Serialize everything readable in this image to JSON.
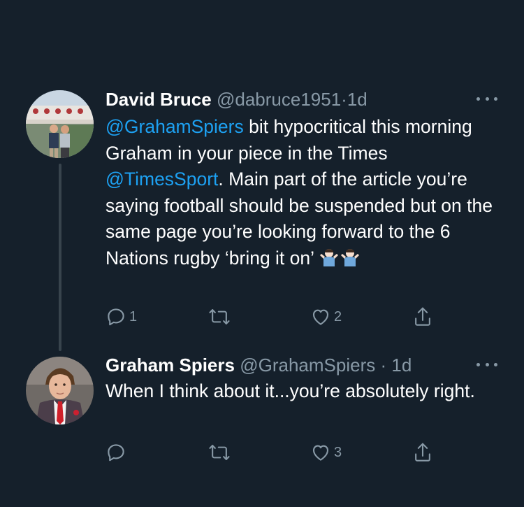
{
  "colors": {
    "background": "#15202b",
    "text_primary": "#ffffff",
    "text_secondary": "#8899a6",
    "link": "#1da1f2",
    "thread_line": "#38444d"
  },
  "tweets": [
    {
      "display_name": "David Bruce",
      "handle": "@dabruce1951",
      "separator": "·",
      "timestamp": "1d",
      "text_segments": [
        {
          "text": "@GrahamSpiers",
          "type": "mention"
        },
        {
          "text": " bit hypocritical this morning Graham in your piece in the Times ",
          "type": "text"
        },
        {
          "text": "@TimesSport",
          "type": "mention"
        },
        {
          "text": ". Main part of the article you’re saying football should be suspended but on the same page you’re looking forward to the 6  Nations rugby ‘bring it on’ ",
          "type": "text"
        }
      ],
      "emoji": [
        "person-shrugging-emoji",
        "person-shrugging-emoji"
      ],
      "reply_count": "1",
      "retweet_count": "",
      "like_count": "2",
      "avatar_icon": "avatar-photo-two-people-icon"
    },
    {
      "display_name": "Graham Spiers",
      "handle": "@GrahamSpiers",
      "separator": "·",
      "timestamp": "1d",
      "text": "When I think about it...you’re absolutely right.",
      "reply_count": "",
      "retweet_count": "",
      "like_count": "3",
      "avatar_icon": "avatar-photo-boy-suit-icon"
    }
  ],
  "icons": {
    "reply": "reply-icon",
    "retweet": "retweet-icon",
    "like": "like-icon",
    "share": "share-icon",
    "more": "more-options-icon"
  }
}
